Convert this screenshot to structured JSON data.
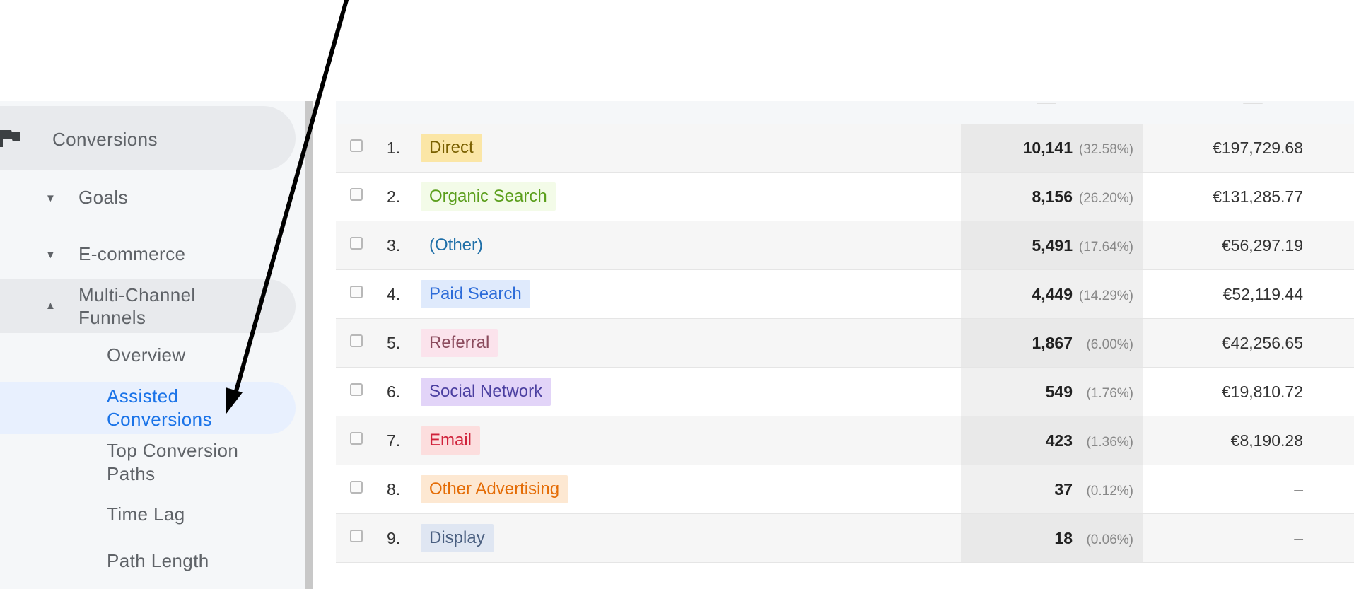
{
  "sidebar": {
    "conversions_label": "Conversions",
    "goals_label": "Goals",
    "ecommerce_label": "E-commerce",
    "multichannel_label_line1": "Multi-Channel",
    "multichannel_label_line2": "Funnels",
    "sub_items": {
      "overview": "Overview",
      "assisted_line1": "Assisted",
      "assisted_line2": "Conversions",
      "top_paths_line1": "Top Conversion",
      "top_paths_line2": "Paths",
      "time_lag": "Time Lag",
      "path_length": "Path Length"
    },
    "caret_collapsed": "▼",
    "caret_expanded": "▲",
    "active_color": "#1a73e8"
  },
  "table": {
    "rows": [
      {
        "num": "1.",
        "channel": "Direct",
        "chip_bg": "#fbe6a6",
        "chip_fg": "#7a6000",
        "value": "10,141",
        "pct": "(32.58%)",
        "revenue": "€197,729.68"
      },
      {
        "num": "2.",
        "channel": "Organic Search",
        "chip_bg": "#f3fbe8",
        "chip_fg": "#5a9e1b",
        "value": "8,156",
        "pct": "(26.20%)",
        "revenue": "€131,285.77"
      },
      {
        "num": "3.",
        "channel": "(Other)",
        "chip_bg": "transparent",
        "chip_fg": "#1f6fa8",
        "value": "5,491",
        "pct": "(17.64%)",
        "revenue": "€56,297.19"
      },
      {
        "num": "4.",
        "channel": "Paid Search",
        "chip_bg": "#dfeafc",
        "chip_fg": "#2c6bd8",
        "value": "4,449",
        "pct": "(14.29%)",
        "revenue": "€52,119.44"
      },
      {
        "num": "5.",
        "channel": "Referral",
        "chip_bg": "#fbe3ec",
        "chip_fg": "#8a4a5c",
        "value": "1,867",
        "pct": "(6.00%)",
        "revenue": "€42,256.65"
      },
      {
        "num": "6.",
        "channel": "Social Network",
        "chip_bg": "#e2d4f8",
        "chip_fg": "#4b3fa0",
        "value": "549",
        "pct": "(1.76%)",
        "revenue": "€19,810.72"
      },
      {
        "num": "7.",
        "channel": "Email",
        "chip_bg": "#fcdede",
        "chip_fg": "#d0223a",
        "value": "423",
        "pct": "(1.36%)",
        "revenue": "€8,190.28"
      },
      {
        "num": "8.",
        "channel": "Other Advertising",
        "chip_bg": "#fde8d2",
        "chip_fg": "#e46c06",
        "value": "37",
        "pct": "(0.12%)",
        "revenue": "–"
      },
      {
        "num": "9.",
        "channel": "Display",
        "chip_bg": "#dfe6f2",
        "chip_fg": "#4a5f80",
        "value": "18",
        "pct": "(0.06%)",
        "revenue": "–"
      }
    ]
  },
  "annotation": {
    "type": "black-arrow-pointing-to-assisted-conversions",
    "color": "#000000"
  }
}
